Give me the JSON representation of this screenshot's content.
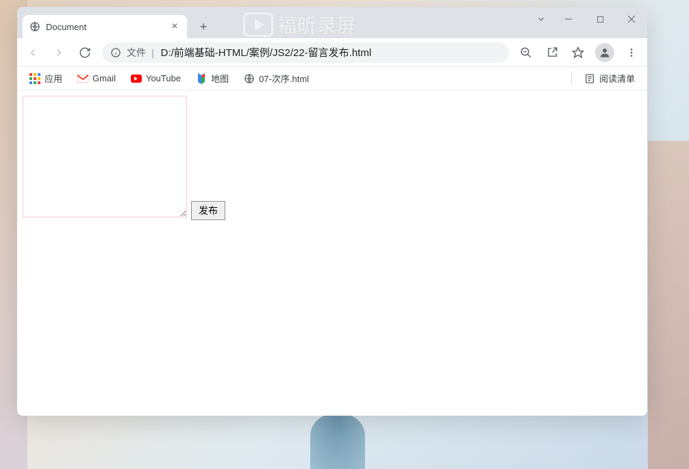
{
  "window": {
    "tab_title": "Document",
    "watermark_text": "福昕录屏"
  },
  "address": {
    "file_label": "文件",
    "url": "D:/前端基础-HTML/案例/JS2/22-留言发布.html"
  },
  "bookmarks": {
    "apps": "应用",
    "gmail": "Gmail",
    "youtube": "YouTube",
    "maps": "地图",
    "custom1": "07-次序.html",
    "reading_list": "阅读清单"
  },
  "page": {
    "textarea_value": "",
    "publish_button": "发布"
  }
}
